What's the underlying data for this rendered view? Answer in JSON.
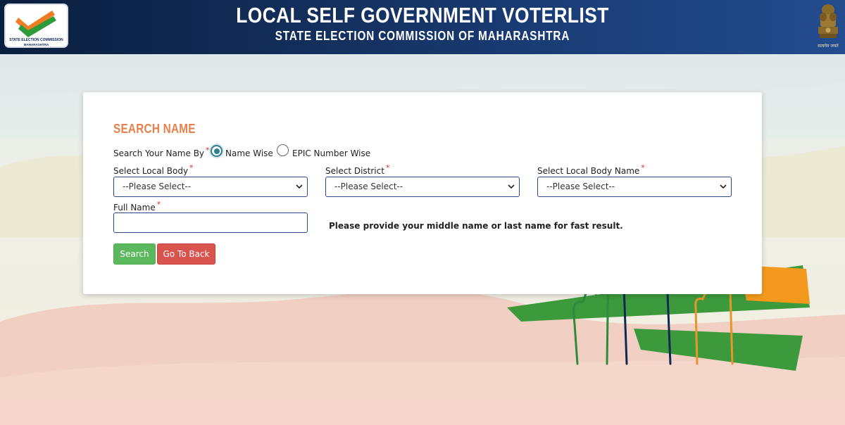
{
  "header": {
    "title": "LOCAL SELF GOVERNMENT VOTERLIST",
    "subtitle": "STATE ELECTION COMMISSION OF MAHARASHTRA",
    "logo_line1": "STATE ELECTION COMMISSION",
    "logo_line2": "MAHARASHTRA",
    "emblem_caption": "सत्यमेव जयते"
  },
  "form": {
    "heading": "SEARCH NAME",
    "search_by_label": "Search Your Name By",
    "required_mark": "*",
    "options": [
      {
        "label": "Name Wise",
        "checked": true
      },
      {
        "label": "EPIC Number Wise",
        "checked": false
      }
    ],
    "local_body_label": "Select Local Body",
    "local_body_value": "--Please Select--",
    "district_label": "Select District",
    "district_value": "--Please Select--",
    "local_body_name_label": "Select Local Body Name",
    "local_body_name_value": "--Please Select--",
    "full_name_label": "Full Name",
    "full_name_value": "",
    "hint": "Please provide your middle name or last name for fast result.",
    "search_button": "Search",
    "back_button": "Go To Back"
  },
  "colors": {
    "accent": "#e8804b",
    "header_bg": "#14305e",
    "search_btn": "#5cb85c",
    "back_btn": "#d9534f"
  }
}
